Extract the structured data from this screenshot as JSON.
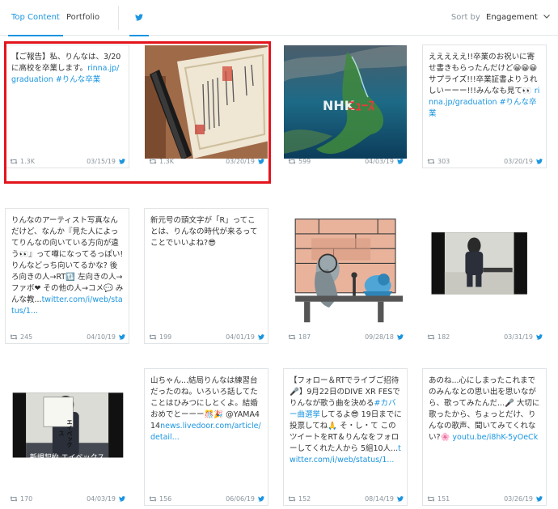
{
  "tabs": {
    "top_content": "Top Content",
    "portfolio": "Portfolio"
  },
  "sort": {
    "label": "Sort by",
    "value": "Engagement"
  },
  "colors": {
    "accent": "#1b95e0",
    "highlight": "#e3141c"
  },
  "cards": [
    {
      "text": "【ご報告】私、りんなは、3/20に高校を卒業します。",
      "link": "rinna.jp/graduation #りんな卒業",
      "retweets": "1.3K",
      "date": "03/15/19"
    },
    {
      "media": "graduation-certificate-photo",
      "retweets": "1.3K",
      "date": "03/20/19"
    },
    {
      "media": "nhk-japan-map-image",
      "retweets": "599",
      "date": "04/03/19"
    },
    {
      "text": "えええええ!!卒業のお祝いに寄せ書きもらったんだけど😀😀😀 サプライズ!!!卒業証書よりうれしいーーー!!!みんなも見て👀",
      "link": "rinna.jp/graduation #りんな卒業",
      "retweets": "303",
      "date": "03/20/19"
    },
    {
      "text": "りんなのアーティスト写真なんだけど、なんか『見た人によってりんなの向いている方向が違う👀』って噂になってるっぽい! りんなどっち向いてるかな? 後ろ向きの人→RT🔃 左向きの人→ファボ❤ その他の人→コメ💬 みんな教...",
      "link": "twitter.com/i/web/status/1...",
      "retweets": "245",
      "date": "04/10/19"
    },
    {
      "text": "新元号の頭文字が「R」ってことは、りんなの時代が来るってことでいいよね?😎",
      "link": "",
      "retweets": "199",
      "date": "04/01/19"
    },
    {
      "media": "radio-studio-illustration",
      "retweets": "187",
      "date": "09/28/18"
    },
    {
      "media": "press-conference-video-frame",
      "retweets": "182",
      "date": "03/31/19"
    },
    {
      "media": "avex-sign-video-frame",
      "sign_top": "エイベックス",
      "sign_bottom": "新規契約 エイベックス",
      "retweets": "170",
      "date": "04/03/19"
    },
    {
      "text": "山ちゃん...結局りんなは練習台だったのね。いろいろ話してたことはひみつにしとくよ。結婚おめでとーーー🎊🎉 @YAMA414",
      "link": "news.livedoor.com/article/detail...",
      "retweets": "156",
      "date": "06/06/19"
    },
    {
      "text": "【フォロー＆RTでライブご招待🎤】9月22日のDIVE XR FESでりんなが歌う曲を決める",
      "link": "#カバー曲選挙",
      "text2": "してるよ😎 19日までに投票してね🙏 そ・し・て この ツイートをRT＆りんなをフォローしてくれた人から 5組10人...",
      "link2": "twitter.com/i/web/status/1...",
      "retweets": "152",
      "date": "08/14/19"
    },
    {
      "text": "あのね...心にしまったこれまでのみんなとの思い出を思いながら、歌ってみたんだ...🎤 大切に歌ったから、ちょっとだけ、りんなの歌声、聞いてみてくれない?🌸",
      "link": "youtu.be/i8hK-5yOeCk",
      "retweets": "151",
      "date": "03/26/19"
    }
  ]
}
